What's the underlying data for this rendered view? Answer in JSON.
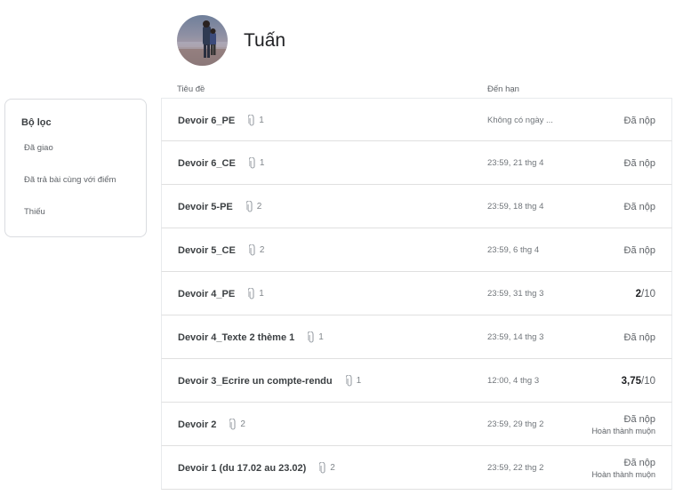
{
  "student": {
    "name": "Tuấn"
  },
  "filters": {
    "title": "Bộ lọc",
    "items": [
      "Đã giao",
      "Đã trả bài cùng với điểm",
      "Thiếu"
    ]
  },
  "columns": {
    "title": "Tiêu đề",
    "due": "Đến hạn"
  },
  "assignments": [
    {
      "title": "Devoir 6_PE",
      "attachments": "1",
      "due": "Không có ngày ...",
      "status": "Đã nộp",
      "sub": "",
      "grade": "",
      "max": ""
    },
    {
      "title": "Devoir 6_CE",
      "attachments": "1",
      "due": "23:59, 21 thg 4",
      "status": "Đã nộp",
      "sub": "",
      "grade": "",
      "max": ""
    },
    {
      "title": "Devoir 5-PE",
      "attachments": "2",
      "due": "23:59, 18 thg 4",
      "status": "Đã nộp",
      "sub": "",
      "grade": "",
      "max": ""
    },
    {
      "title": "Devoir 5_CE",
      "attachments": "2",
      "due": "23:59, 6 thg 4",
      "status": "Đã nộp",
      "sub": "",
      "grade": "",
      "max": ""
    },
    {
      "title": "Devoir 4_PE",
      "attachments": "1",
      "due": "23:59, 31 thg 3",
      "status": "",
      "sub": "",
      "grade": "2",
      "max": "/10"
    },
    {
      "title": "Devoir 4_Texte 2 thème 1",
      "attachments": "1",
      "due": "23:59, 14 thg 3",
      "status": "Đã nộp",
      "sub": "",
      "grade": "",
      "max": ""
    },
    {
      "title": "Devoir 3_Ecrire un compte-rendu",
      "attachments": "1",
      "due": "12:00, 4 thg 3",
      "status": "",
      "sub": "",
      "grade": "3,75",
      "max": "/10"
    },
    {
      "title": "Devoir 2",
      "attachments": "2",
      "due": "23:59, 29 thg 2",
      "status": "Đã nộp",
      "sub": "Hoàn thành muộn",
      "grade": "",
      "max": ""
    },
    {
      "title": "Devoir 1 (du 17.02 au 23.02)",
      "attachments": "2",
      "due": "23:59, 22 thg 2",
      "status": "Đã nộp",
      "sub": "Hoàn thành muộn",
      "grade": "",
      "max": ""
    }
  ],
  "icons": {
    "attachment": "paperclip-icon"
  }
}
